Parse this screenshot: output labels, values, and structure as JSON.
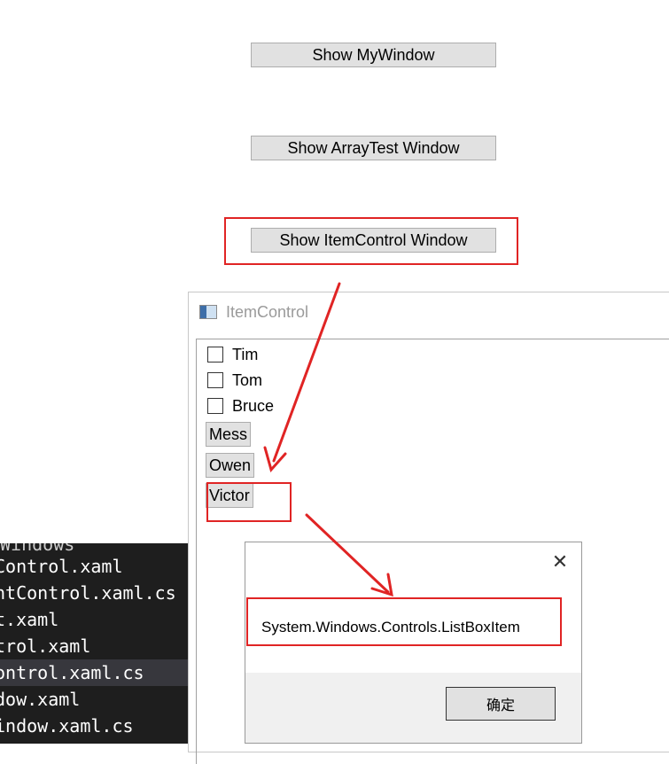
{
  "main_window": {
    "buttons": [
      {
        "label": "Show MyWindow"
      },
      {
        "label": "Show ArrayTest Window"
      },
      {
        "label": "Show ItemControl Window"
      }
    ]
  },
  "code_panel": {
    "lines": [
      {
        "text": "Windows",
        "selected": false
      },
      {
        "text": "Control.xaml",
        "selected": false
      },
      {
        "text": "ntControl.xaml.cs",
        "selected": false
      },
      {
        "text": "t.xaml",
        "selected": false
      },
      {
        "text": "trol.xaml",
        "selected": false
      },
      {
        "text": "ontrol.xaml.cs",
        "selected": true
      },
      {
        "text": "dow.xaml",
        "selected": false
      },
      {
        "text": "indow.xaml.cs",
        "selected": false
      }
    ]
  },
  "item_window": {
    "title": "ItemControl",
    "checkboxes": [
      {
        "label": "Tim"
      },
      {
        "label": "Tom"
      },
      {
        "label": "Bruce"
      }
    ],
    "buttons": [
      {
        "label": "Mess"
      },
      {
        "label": "Owen"
      },
      {
        "label": "Victor"
      }
    ]
  },
  "message_box": {
    "message": "System.Windows.Controls.ListBoxItem",
    "ok_label": "确定",
    "close_glyph": "✕"
  },
  "colors": {
    "annotation_red": "#e02424",
    "editor_bg": "#1e1e1e",
    "button_face": "#e1e1e1"
  }
}
